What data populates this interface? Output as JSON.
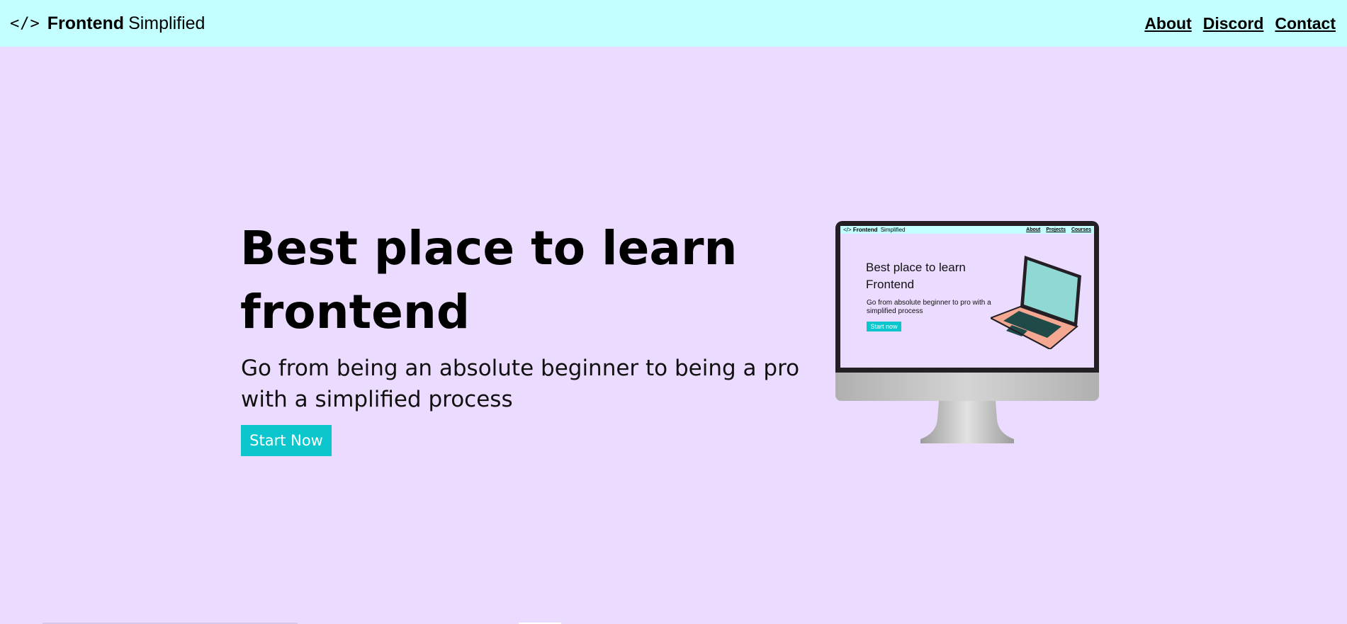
{
  "navbar": {
    "logo_glyph": "</>",
    "brand_bold": "Frontend",
    "brand_light": "Simplified",
    "links": [
      "About",
      "Discord",
      "Contact"
    ]
  },
  "hero": {
    "title": "Best place to learn frontend",
    "subtitle": "Go from being an absolute beginner to being a pro with a simplified process",
    "cta_label": "Start Now"
  },
  "illustration": {
    "mini_nav": {
      "logo_glyph": "</>",
      "brand_bold": "Frontend",
      "brand_light": "Simplified",
      "links": [
        "About",
        "Projects",
        "Courses"
      ]
    },
    "mini_title": "Best place to learn Frontend",
    "mini_subtitle": "Go from absolute beginner to pro with a simplified process",
    "mini_cta": "Start now"
  },
  "colors": {
    "background": "#ebdbff",
    "navbar": "#c4ffff",
    "accent": "#0bc6cd"
  }
}
